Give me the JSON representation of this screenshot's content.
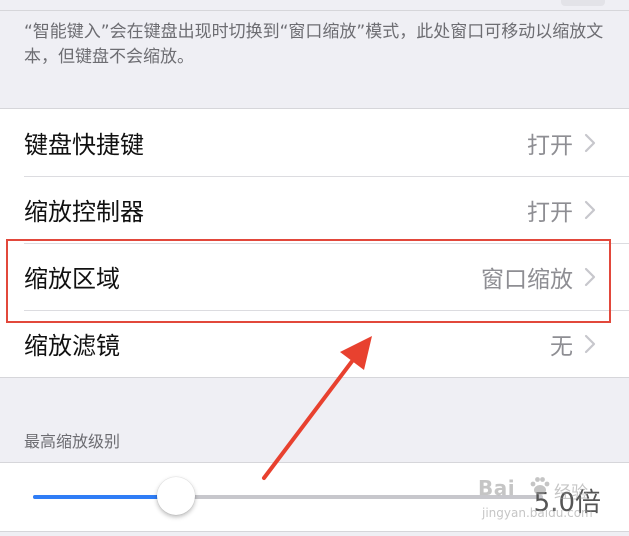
{
  "smart_typing_footer": "“智能键入”会在键盘出现时切换到“窗口缩放”模式，此处窗口可移动以缩放文本，但键盘不会缩放。",
  "settings": [
    {
      "label": "键盘快捷键",
      "value": "打开"
    },
    {
      "label": "缩放控制器",
      "value": "打开"
    },
    {
      "label": "缩放区域",
      "value": "窗口缩放"
    },
    {
      "label": "缩放滤镜",
      "value": "无"
    }
  ],
  "max_zoom": {
    "header": "最高缩放级别",
    "value_label": "5.0倍",
    "slider_fraction": 0.28
  },
  "watermark": {
    "brand": "Bai",
    "brand_suffix": "经验",
    "url": "jingyan.baidu.com"
  },
  "colors": {
    "highlight": "#e2483b",
    "arrow": "#e8412f",
    "slider_accent": "#2f7df6"
  },
  "icons": {
    "chevron": "chevron-right-icon",
    "paw": "baidu-paw-icon"
  }
}
